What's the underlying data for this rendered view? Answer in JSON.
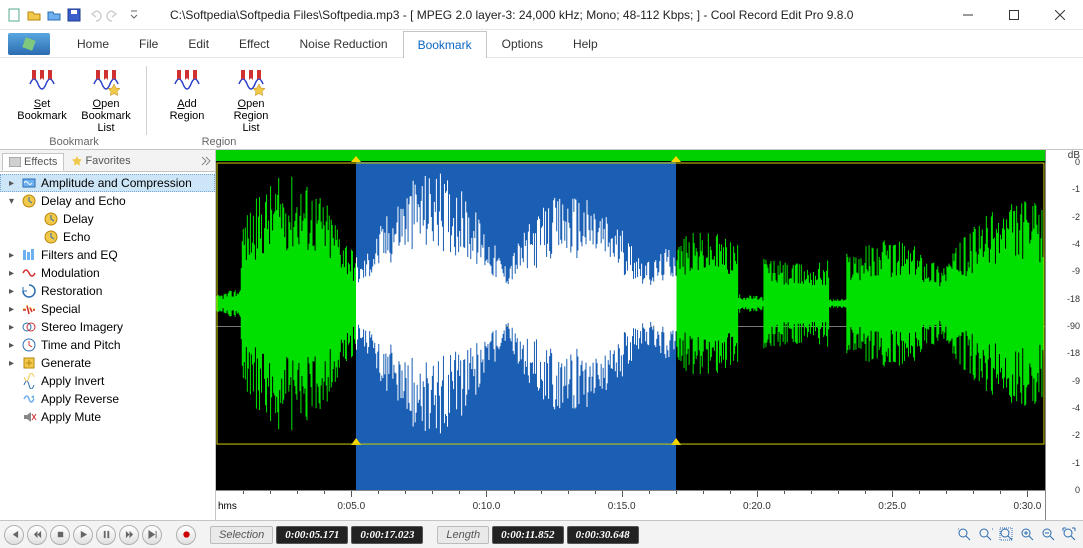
{
  "window": {
    "title": "C:\\Softpedia\\Softpedia Files\\Softpedia.mp3 - [ MPEG 2.0 layer-3: 24,000 kHz; Mono; 48-112 Kbps;  ] - Cool Record Edit Pro 9.8.0"
  },
  "tabs": [
    "Home",
    "File",
    "Edit",
    "Effect",
    "Noise Reduction",
    "Bookmark",
    "Options",
    "Help"
  ],
  "active_tab": "Bookmark",
  "ribbon": {
    "groups": [
      {
        "title": "Bookmark",
        "buttons": [
          {
            "id": "set-bookmark",
            "label_line1": "Set",
            "label_line2": "Bookmark"
          },
          {
            "id": "open-bookmark-list",
            "label_line1": "Open",
            "label_line2": "Bookmark List"
          }
        ]
      },
      {
        "title": "Region",
        "buttons": [
          {
            "id": "add-region",
            "label_line1": "Add",
            "label_line2": "Region"
          },
          {
            "id": "open-region-list",
            "label_line1": "Open",
            "label_line2": "Region List"
          }
        ]
      }
    ]
  },
  "sidebar": {
    "tabs": [
      "Effects",
      "Favorites"
    ],
    "active": "Effects",
    "nodes": [
      {
        "id": "amp-comp",
        "label": "Amplitude and Compression",
        "expandable": true,
        "expanded": false,
        "selected": true,
        "icon": "wave"
      },
      {
        "id": "delay-echo",
        "label": "Delay and Echo",
        "expandable": true,
        "expanded": true,
        "icon": "clock",
        "children": [
          {
            "id": "delay",
            "label": "Delay",
            "icon": "clock"
          },
          {
            "id": "echo",
            "label": "Echo",
            "icon": "clock"
          }
        ]
      },
      {
        "id": "filters-eq",
        "label": "Filters and EQ",
        "expandable": true,
        "icon": "eq"
      },
      {
        "id": "modulation",
        "label": "Modulation",
        "expandable": true,
        "icon": "mod"
      },
      {
        "id": "restoration",
        "label": "Restoration",
        "expandable": true,
        "icon": "restore"
      },
      {
        "id": "special",
        "label": "Special",
        "expandable": true,
        "icon": "special"
      },
      {
        "id": "stereo",
        "label": "Stereo Imagery",
        "expandable": true,
        "icon": "stereo"
      },
      {
        "id": "time-pitch",
        "label": "Time and Pitch",
        "expandable": true,
        "icon": "time"
      },
      {
        "id": "generate",
        "label": "Generate",
        "expandable": true,
        "icon": "gen"
      },
      {
        "id": "invert",
        "label": "Apply Invert",
        "expandable": false,
        "icon": "invert"
      },
      {
        "id": "reverse",
        "label": "Apply Reverse",
        "expandable": false,
        "icon": "reverse"
      },
      {
        "id": "mute",
        "label": "Apply Mute",
        "expandable": false,
        "icon": "mute"
      }
    ]
  },
  "db_scale": {
    "title": "dB",
    "values": [
      "0",
      "-1",
      "-2",
      "-4",
      "-9",
      "-18",
      "-90",
      "-18",
      "-9",
      "-4",
      "-2",
      "-1",
      "0"
    ]
  },
  "time_ruler": {
    "hms": "hms",
    "ticks": [
      "0:05.0",
      "0:10.0",
      "0:15.0",
      "0:20.0",
      "0:25.0",
      "0:30.0"
    ]
  },
  "status": {
    "selection_label": "Selection",
    "selection_start": "0:00:05.171",
    "selection_end": "0:00:17.023",
    "length_label": "Length",
    "length_sel": "0:00:11.852",
    "length_total": "0:00:30.648"
  },
  "waveform": {
    "selection_start_pct": 16.9,
    "selection_end_pct": 55.5
  }
}
